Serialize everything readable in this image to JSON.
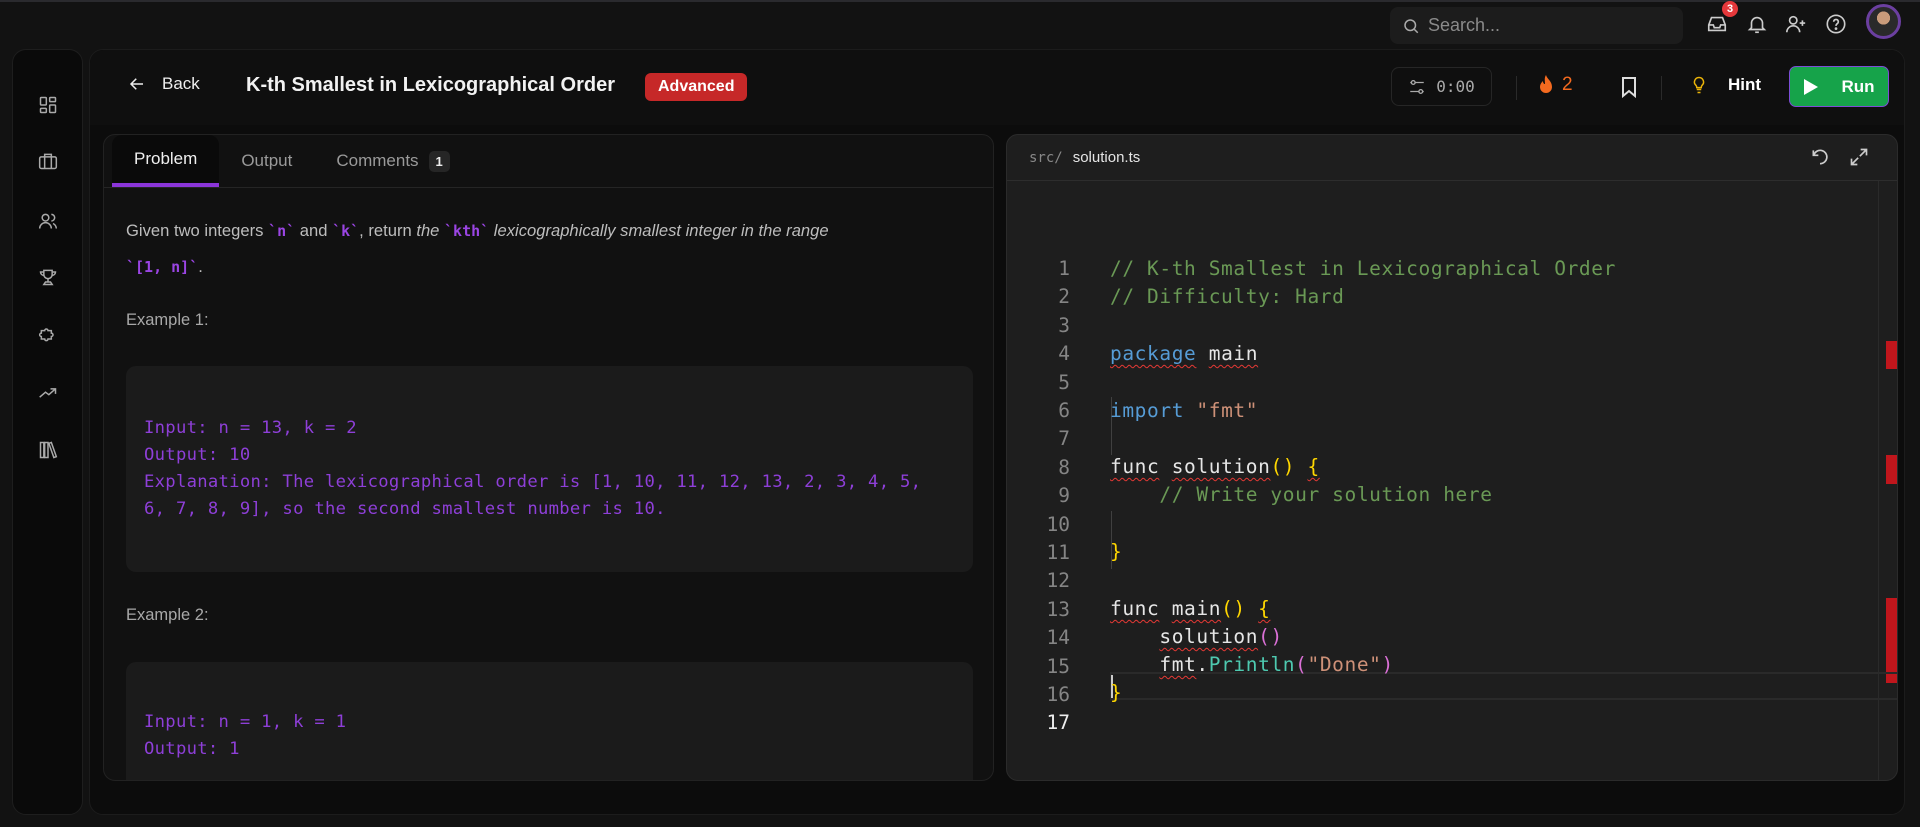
{
  "topbar": {
    "search_placeholder": "Search...",
    "inbox_count": "3",
    "icons": [
      "search-icon",
      "inbox-icon",
      "bell-icon",
      "user-plus-icon",
      "help-icon",
      "avatar"
    ]
  },
  "sidebar": {
    "items": [
      "dashboard-icon",
      "briefcase-icon",
      "users-icon",
      "trophy-icon",
      "puzzle-icon",
      "trending-up-icon",
      "library-icon"
    ]
  },
  "header": {
    "back_label": "Back",
    "title": "K-th Smallest in Lexicographical Order",
    "difficulty": "Advanced",
    "timer": "0:00",
    "streak": "2",
    "hint_label": "Hint",
    "run_label": "Run"
  },
  "problem": {
    "tabs": [
      {
        "label": "Problem"
      },
      {
        "label": "Output"
      },
      {
        "label": "Comments",
        "count": "1"
      }
    ],
    "desc": {
      "t1": "Given two integers ",
      "c1": "`n`",
      "t2": " and ",
      "c2": "`k`",
      "t3": ", return ",
      "i1": "the ",
      "c3": "`kth`",
      "i2": " lexicographically smallest integer in the range",
      "c4": "`[1, n]`",
      "t4": "."
    },
    "examples": [
      {
        "label": "Example 1:",
        "lines": [
          "Input: n = 13, k = 2",
          "Output: 10",
          "Explanation: The lexicographical order is [1, 10, 11, 12, 13, 2, 3, 4, 5,",
          "6, 7, 8, 9], so the second smallest number is 10."
        ]
      },
      {
        "label": "Example 2:",
        "lines": [
          "Input: n = 1, k = 1",
          "Output: 1"
        ]
      }
    ]
  },
  "editor": {
    "path_prefix": "src/",
    "filename": "solution.ts",
    "line_numbers": [
      "1",
      "2",
      "3",
      "4",
      "5",
      "6",
      "7",
      "8",
      "9",
      "10",
      "11",
      "12",
      "13",
      "14",
      "15",
      "16",
      "17"
    ],
    "code": {
      "l1": "// K-th Smallest in Lexicographical Order",
      "l2": "// Difficulty: Hard",
      "l4a": "package",
      "l4b": "main",
      "l6a": "import",
      "l6b": "\"fmt\"",
      "l8a": "func",
      "l8b": "solution",
      "l8c": "()",
      "l8d": "{",
      "l9": "// Write your solution here",
      "l11": "}",
      "l13a": "func",
      "l13b": "main",
      "l13c": "()",
      "l13d": "{",
      "l14a": "solution",
      "l14b": "()",
      "l15a": "fmt",
      "l15b": ".",
      "l15c": "Println",
      "l15d": "(",
      "l15e": "\"Done\"",
      "l15f": ")",
      "l16": "}"
    }
  }
}
